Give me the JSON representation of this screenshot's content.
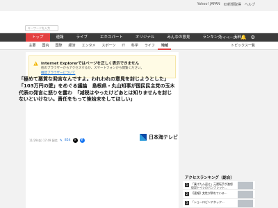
{
  "top_links": [
    "Yahoo! JAPAN",
    "ID新規取得",
    "ヘルプ"
  ],
  "search": {
    "placeholder": "キーワードを入力"
  },
  "nav_primary": {
    "items": [
      "トップ",
      "速報",
      "ライブ",
      "エキスパート",
      "オリジナル",
      "みんなの意見",
      "ランキング",
      "有料"
    ],
    "active_index": 0,
    "mypage_label": "マイページ"
  },
  "nav_secondary": {
    "items": [
      "主要",
      "国内",
      "国際",
      "経済",
      "エンタメ",
      "スポーツ",
      "IT",
      "科学",
      "ライフ",
      "地域"
    ],
    "active_index": 9,
    "right_label": "トピックス一覧"
  },
  "notice": {
    "title": "Internet Explorerではページを正しく表示できません",
    "body": "他のブラウザーからアクセスするか、スマートフォンから閲覧ください。",
    "link": "推奨ブラウザーについて"
  },
  "article": {
    "headline": "「極めて悪質な発言なんですよ。われわれの意見を封じようとした」「103万円の壁」をめぐる議論　島根県・丸山知事が国民民主党の玉木代表の発言に怒りを露わ　「减税はやったけどあとは知りませんを封じないといけない。責任をもって後始末をしてほしい」",
    "date": "11/29(金) 17:49 配信",
    "comment_count": "854",
    "source": "日本海テレビ"
  },
  "ranking": {
    "title": "アクセスランキング（総合）",
    "items": [
      {
        "rank": "1",
        "text": "「乗げたん返せ」元運転手が激怒 仮設トイレのパンフレット..."
      },
      {
        "rank": "2",
        "text": "【速報】女性が倒れている..."
      },
      {
        "rank": "3",
        "text": "「ショーロビンアタック..."
      }
    ]
  },
  "colors": {
    "accent": "#e34040",
    "link": "#1a6fd6",
    "nav_bg": "#3b3b3b"
  }
}
